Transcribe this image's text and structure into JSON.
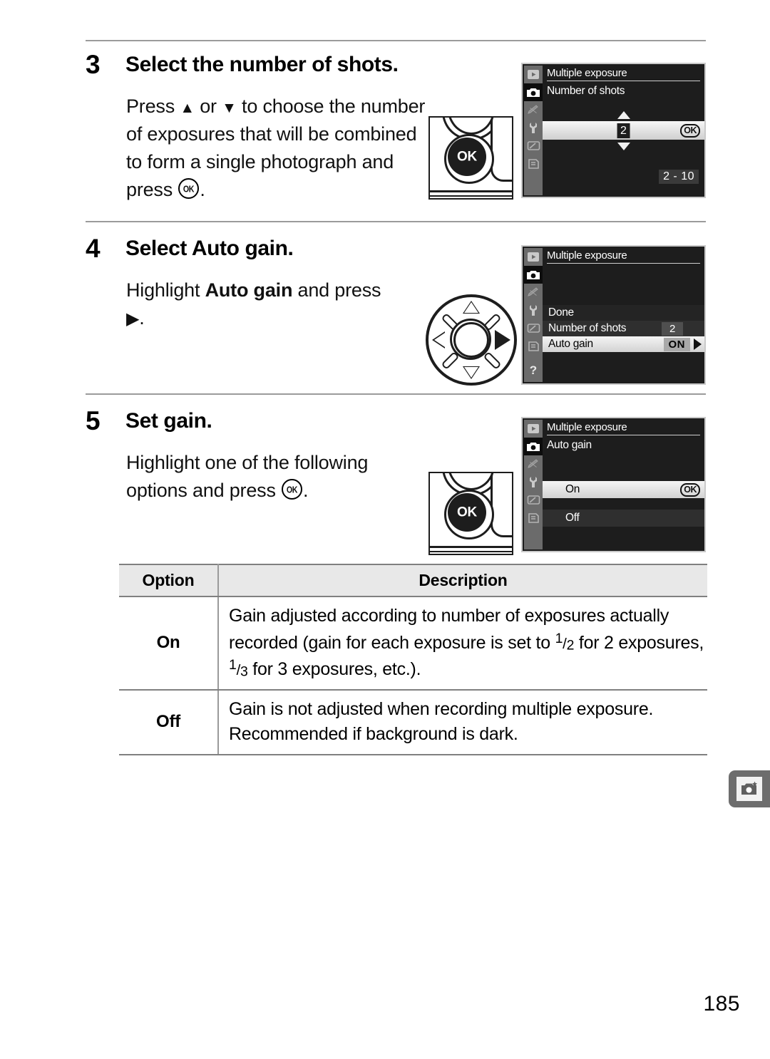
{
  "page": {
    "folio": "185",
    "side_tab_icon": "camera-star-icon"
  },
  "steps": [
    {
      "number": "3",
      "title": "Select the number of shots.",
      "body_prefix": "Press ",
      "body_mid": " or ",
      "body_text": " to choose the number of exposures that will be combined to form a single photograph and press ",
      "body_suffix": ".",
      "up_icon": "triangle-up-icon",
      "down_icon": "triangle-down-icon",
      "ok_icon": "ok-button-icon",
      "illustration": "ok-button-photo"
    },
    {
      "number": "4",
      "title_plain": "Select ",
      "title_bold": "Auto gain",
      "title_end": ".",
      "body_prefix": "Highlight ",
      "body_bold": "Auto gain",
      "body_mid": " and press ",
      "body_suffix": ".",
      "right_icon": "triangle-right-icon",
      "illustration": "multi-selector-right"
    },
    {
      "number": "5",
      "title": "Set gain.",
      "body_prefix": "Highlight one of the following options and press ",
      "body_suffix": ".",
      "ok_icon": "ok-button-icon",
      "illustration": "ok-button-photo"
    }
  ],
  "lcd_screens": [
    {
      "id": "number-of-shots",
      "title": "Multiple exposure",
      "subtitle": "Number of shots",
      "spin_value": "2",
      "ok_badge": "OK",
      "range_badge": "2 - 10",
      "selected_tab_index": 1,
      "tabs": [
        "playback-tab-icon",
        "shooting-menu-tab-icon",
        "custom-settings-tab-icon",
        "setup-menu-tab-icon",
        "retouch-tab-icon",
        "recent-settings-tab-icon"
      ]
    },
    {
      "id": "multiple-exposure-menu",
      "title": "Multiple exposure",
      "rows": [
        {
          "label": "Done",
          "value": ""
        },
        {
          "label": "Number of shots",
          "value": "2"
        },
        {
          "label": "Auto gain",
          "value": "ON"
        }
      ],
      "highlighted_row": 2,
      "help_icon": "?",
      "selected_tab_index": 1,
      "tabs": [
        "playback-tab-icon",
        "shooting-menu-tab-icon",
        "custom-settings-tab-icon",
        "setup-menu-tab-icon",
        "retouch-tab-icon",
        "recent-settings-tab-icon"
      ]
    },
    {
      "id": "auto-gain",
      "title": "Multiple exposure",
      "subtitle": "Auto gain",
      "options": [
        {
          "label": "On",
          "badge": "OK"
        },
        {
          "label": "Off",
          "badge": ""
        }
      ],
      "highlighted_option": 0,
      "selected_tab_index": 1,
      "tabs": [
        "playback-tab-icon",
        "shooting-menu-tab-icon",
        "custom-settings-tab-icon",
        "setup-menu-tab-icon",
        "retouch-tab-icon",
        "recent-settings-tab-icon"
      ]
    }
  ],
  "options_table": {
    "headers": [
      "Option",
      "Description"
    ],
    "rows": [
      {
        "option": "On",
        "description_part1": "Gain adjusted according to number of exposures actually recorded (gain for each exposure is set to ",
        "fraction1_num": "1",
        "fraction1_den": "2",
        "description_part2": " for 2 exposures, ",
        "fraction2_num": "1",
        "fraction2_den": "3",
        "description_part3": " for 3 exposures, etc.)."
      },
      {
        "option": "Off",
        "description": "Gain is not adjusted when recording multiple exposure. Recommended if background is dark."
      }
    ]
  }
}
